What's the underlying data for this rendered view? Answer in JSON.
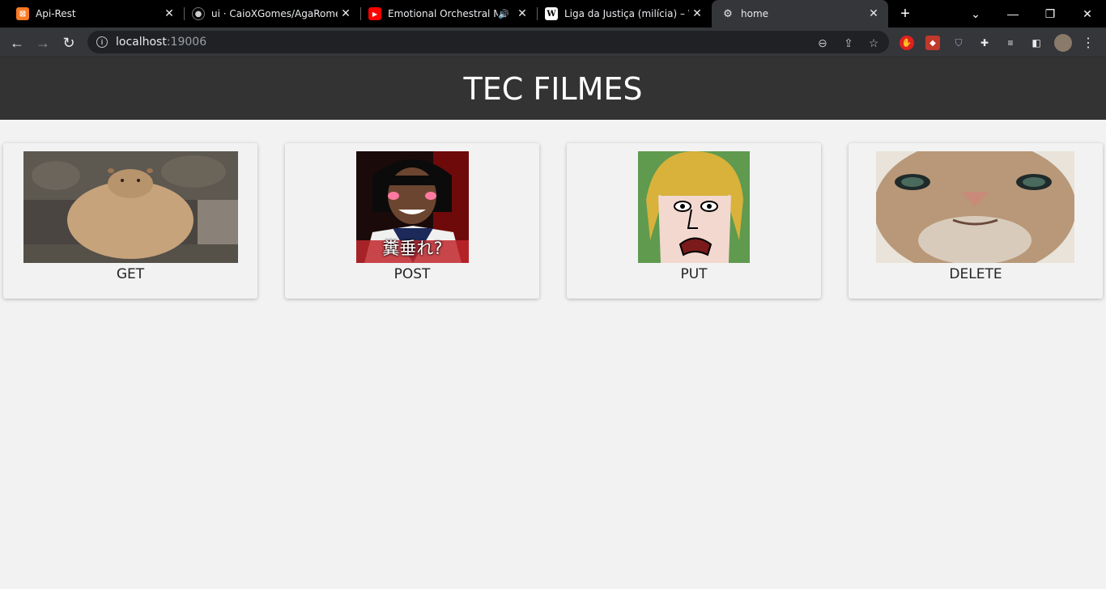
{
  "browser": {
    "tabs": [
      {
        "title": "Api-Rest",
        "icon": "xampp-icon",
        "color": "#fb7a24"
      },
      {
        "title": "ui · CaioXGomes/AgaRomeu",
        "icon": "github-icon",
        "color": "#ffffff"
      },
      {
        "title": "Emotional Orchestral Mu",
        "icon": "youtube-icon",
        "color": "#ff0000"
      },
      {
        "title": "Liga da Justiça (milícia) – Wi",
        "icon": "wikipedia-icon",
        "color": "#ffffff"
      },
      {
        "title": "home",
        "icon": "page-icon",
        "color": "#e8eaed"
      }
    ],
    "url_host": "localhost",
    "url_port": ":19006"
  },
  "page": {
    "title": "TEC FILMES",
    "cards": [
      {
        "label": "GET",
        "image": "capybara-image"
      },
      {
        "label": "POST",
        "image": "meme-person-image"
      },
      {
        "label": "PUT",
        "image": "shaggy-cartoon-image"
      },
      {
        "label": "DELETE",
        "image": "cat-closeup-image"
      }
    ],
    "meme_caption": "糞垂れ?"
  },
  "colors": {
    "header_bg": "#333333",
    "page_bg": "#f2f2f2",
    "tab_active": "#35363a"
  }
}
